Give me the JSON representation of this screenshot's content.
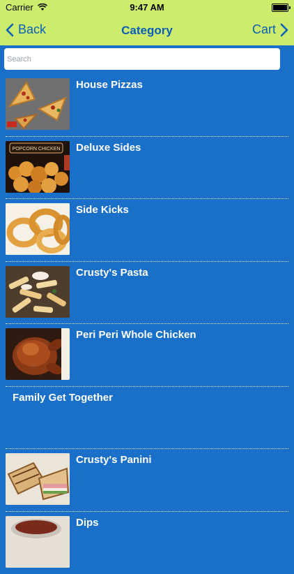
{
  "status_bar": {
    "carrier": "Carrier",
    "time": "9:47 AM"
  },
  "nav": {
    "back_label": "Back",
    "title": "Category",
    "cart_label": "Cart"
  },
  "search": {
    "placeholder": "Search",
    "value": ""
  },
  "categories": [
    {
      "label": "House Pizzas",
      "has_image": true
    },
    {
      "label": "Deluxe Sides",
      "has_image": true,
      "image_text": "POPCORN CHICKEN"
    },
    {
      "label": "Side Kicks",
      "has_image": true
    },
    {
      "label": "Crusty's Pasta",
      "has_image": true
    },
    {
      "label": "Peri Peri Whole Chicken",
      "has_image": true
    },
    {
      "label": "Family Get Together",
      "has_image": false
    },
    {
      "label": "Crusty's Panini",
      "has_image": true
    },
    {
      "label": "Dips",
      "has_image": true
    }
  ],
  "colors": {
    "nav_bar": "#cdec6b",
    "nav_text": "#0b5fb8",
    "background": "#1a6fc9",
    "row_text": "#ffffff"
  }
}
